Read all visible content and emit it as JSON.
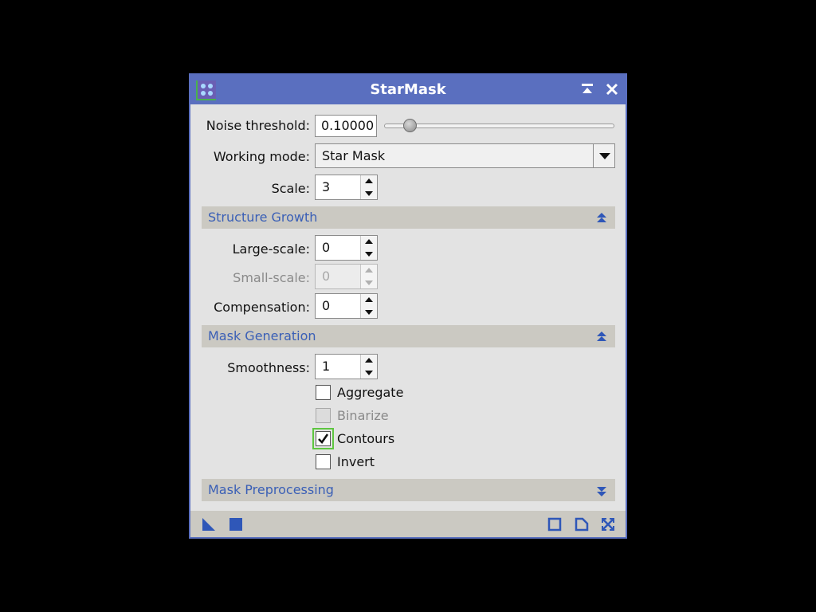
{
  "window": {
    "title": "StarMask",
    "accent": "#5a6fbf",
    "section_text_color": "#3a5fb6"
  },
  "params": {
    "noise_threshold": {
      "label": "Noise threshold:",
      "value": "0.10000",
      "slider_fraction": 0.1
    },
    "working_mode": {
      "label": "Working mode:",
      "value": "Star Mask"
    },
    "scale": {
      "label": "Scale:",
      "value": "3"
    }
  },
  "structure_growth": {
    "title": "Structure Growth",
    "expanded": true,
    "large_scale": {
      "label": "Large-scale:",
      "value": "0"
    },
    "small_scale": {
      "label": "Small-scale:",
      "value": "0",
      "enabled": false
    },
    "compensation": {
      "label": "Compensation:",
      "value": "0"
    }
  },
  "mask_generation": {
    "title": "Mask Generation",
    "expanded": true,
    "smoothness": {
      "label": "Smoothness:",
      "value": "1"
    },
    "checkboxes": [
      {
        "label": "Aggregate",
        "checked": false,
        "enabled": true
      },
      {
        "label": "Binarize",
        "checked": false,
        "enabled": false
      },
      {
        "label": "Contours",
        "checked": true,
        "enabled": true,
        "focused": true
      },
      {
        "label": "Invert",
        "checked": false,
        "enabled": true
      }
    ]
  },
  "mask_preprocessing": {
    "title": "Mask Preprocessing",
    "expanded": false
  },
  "icons": {
    "titlebar": [
      "shade-icon",
      "close-icon"
    ],
    "footer_left": [
      "new-instance-icon",
      "apply-global-icon"
    ],
    "footer_right": [
      "preview-icon",
      "reset-icon",
      "expand-icon"
    ]
  }
}
